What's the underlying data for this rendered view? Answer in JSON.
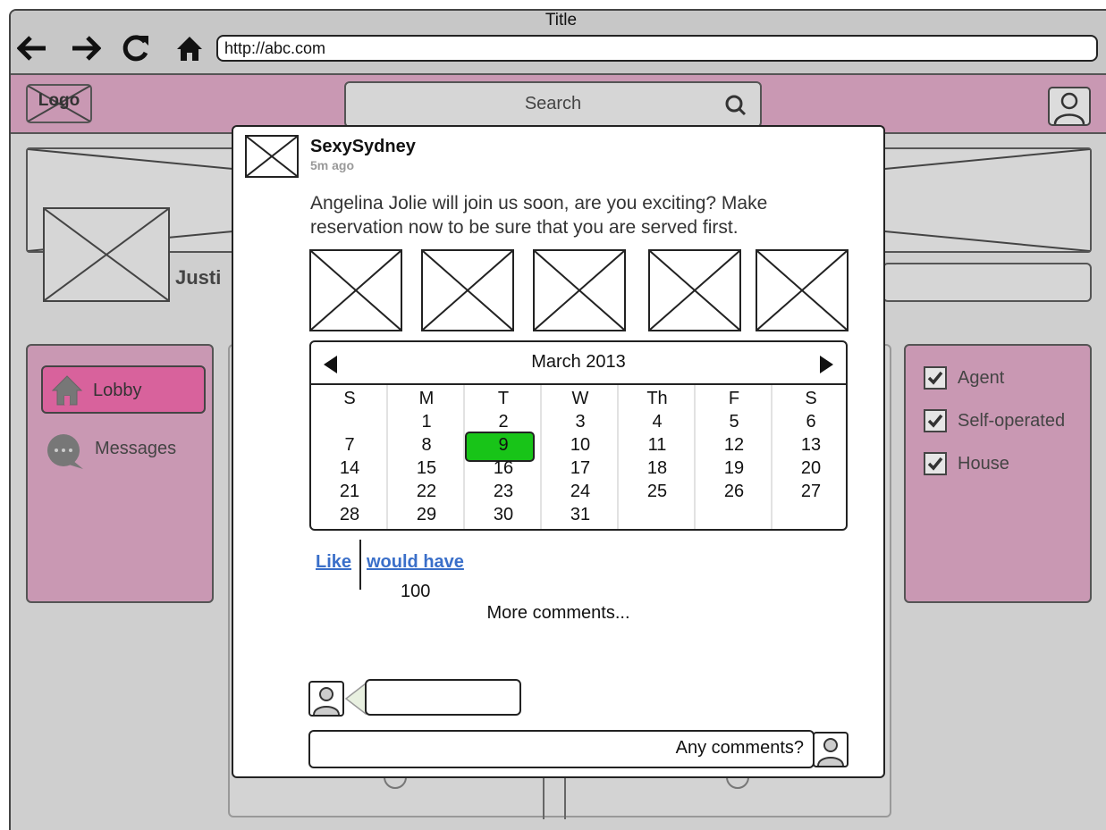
{
  "window": {
    "title": "Title",
    "url": "http://abc.com"
  },
  "header": {
    "logo_text": "Logo",
    "search_placeholder": "Search"
  },
  "profile": {
    "name": "Justi"
  },
  "sidebar": {
    "items": [
      {
        "label": "Lobby",
        "icon": "home-icon",
        "active": true
      },
      {
        "label": "Messages",
        "icon": "chat-bubble-icon",
        "active": false
      }
    ]
  },
  "filters": [
    {
      "label": "Agent",
      "checked": true
    },
    {
      "label": "Self-operated",
      "checked": true
    },
    {
      "label": "House",
      "checked": true
    }
  ],
  "post": {
    "user": "SexySydney",
    "time": "5m ago",
    "text": "Angelina Jolie will join us soon, are you exciting? Make reservation now to be sure that you are served first.",
    "thumbnail_count": 5,
    "like_label": "Like",
    "would_have_label": "would have",
    "like_count": "100",
    "more_comments": "More comments...",
    "comment_placeholder": "Any comments?"
  },
  "calendar": {
    "month_label": "March 2013",
    "weekdays": [
      "S",
      "M",
      "T",
      "W",
      "Th",
      "F",
      "S"
    ],
    "selected_day": "9",
    "weeks": [
      [
        "",
        "1",
        "2",
        "3",
        "4",
        "5",
        "6"
      ],
      [
        "7",
        "8",
        "9",
        "10",
        "11",
        "12",
        "13"
      ],
      [
        "14",
        "15",
        "16",
        "17",
        "18",
        "19",
        "20"
      ],
      [
        "21",
        "22",
        "23",
        "24",
        "25",
        "26",
        "27"
      ],
      [
        "28",
        "29",
        "30",
        "31",
        "",
        "",
        ""
      ]
    ]
  },
  "colors": {
    "accent_pink": "#c998b3",
    "active_pink": "#d8629c",
    "selected_green": "#18c418",
    "link_blue": "#3a6fc9"
  }
}
